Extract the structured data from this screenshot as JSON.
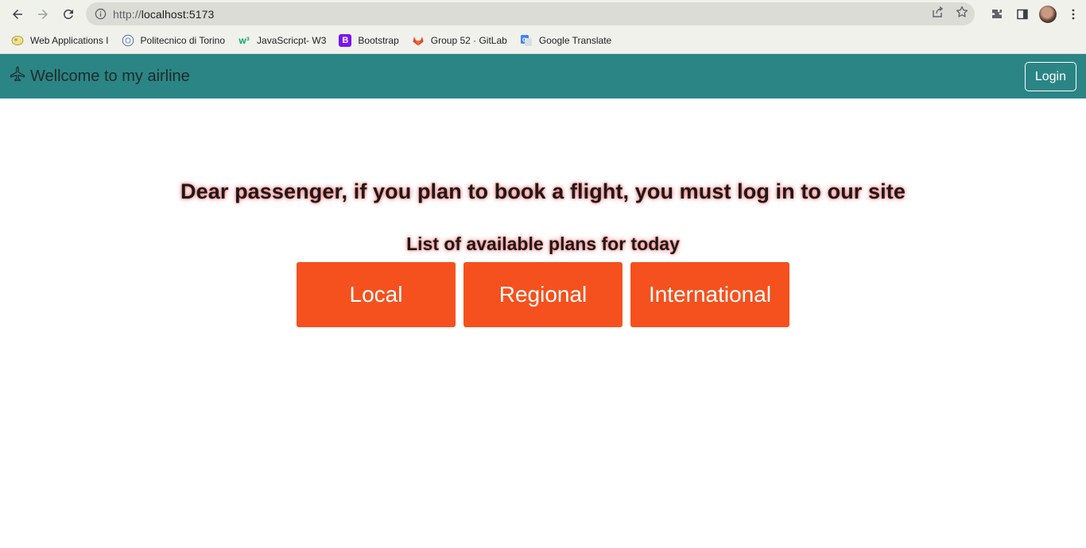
{
  "browser": {
    "url_scheme": "http://",
    "url_host": "localhost:5173",
    "bookmarks": [
      {
        "label": "Web Applications I",
        "icon": "web-apps-favicon"
      },
      {
        "label": "Politecnico di Torino",
        "icon": "polito-favicon"
      },
      {
        "label": "JavaScricpt- W3",
        "icon": "w3schools-favicon"
      },
      {
        "label": "Bootstrap",
        "icon": "bootstrap-favicon"
      },
      {
        "label": "Group 52 · GitLab",
        "icon": "gitlab-favicon"
      },
      {
        "label": "Google Translate",
        "icon": "google-translate-favicon"
      }
    ]
  },
  "navbar": {
    "brand_icon": "airplane-icon",
    "brand_title": "Wellcome to my airline",
    "login_label": "Login"
  },
  "main": {
    "headline": "Dear passenger, if you plan to book a flight, you must log in to our site",
    "subheading": "List of available plans for today",
    "plans": [
      "Local",
      "Regional",
      "International"
    ]
  },
  "colors": {
    "navbar_bg": "#2b8585",
    "plan_button_bg": "#f4511e",
    "text_glow": "#ff5050"
  }
}
